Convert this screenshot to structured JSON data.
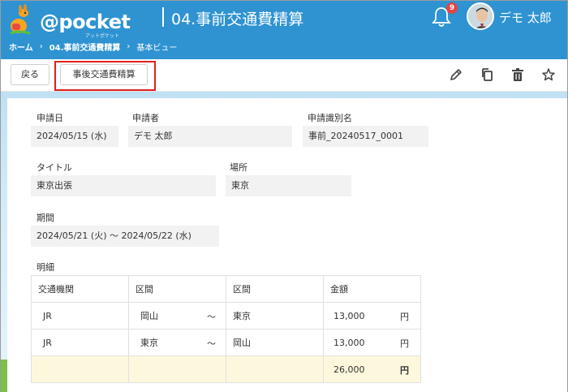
{
  "header": {
    "logo_text": "@pocket",
    "logo_sub": "アットポケット",
    "app_title": "04.事前交通費精算",
    "notification_count": "9",
    "user_name": "デモ 太郎"
  },
  "breadcrumb": {
    "home": "ホーム",
    "app": "04.事前交通費精算",
    "view": "基本ビュー",
    "separator": "›"
  },
  "toolbar": {
    "back_label": "戻る",
    "followup_label": "事後交通費精算",
    "icons": [
      "pencil-icon",
      "copy-icon",
      "trash-icon",
      "star-icon"
    ]
  },
  "form": {
    "application_date": {
      "label": "申請日",
      "value": "2024/05/15 (水)"
    },
    "applicant": {
      "label": "申請者",
      "value": "デモ 太郎"
    },
    "request_id": {
      "label": "申請識別名",
      "value": "事前_20240517_0001"
    },
    "title": {
      "label": "タイトル",
      "value": "東京出張"
    },
    "place": {
      "label": "場所",
      "value": "東京"
    },
    "period": {
      "label": "期間",
      "value": "2024/05/21 (火) ～ 2024/05/22 (水)"
    }
  },
  "details": {
    "label": "明細",
    "columns": [
      "交通機関",
      "区間",
      "区間",
      "金額"
    ],
    "rows": [
      {
        "transport": "JR",
        "from": "岡山",
        "tilde": "～",
        "to": "東京",
        "amount": "13,000",
        "unit": "円"
      },
      {
        "transport": "JR",
        "from": "東京",
        "tilde": "～",
        "to": "岡山",
        "amount": "13,000",
        "unit": "円"
      }
    ],
    "total": {
      "amount": "26,000",
      "unit": "円"
    }
  },
  "colors": {
    "header_bg": "#2f93d2",
    "highlight": "#e0201e",
    "total_row_bg": "#fdf8dd",
    "field_bg": "#f2f2f2"
  }
}
